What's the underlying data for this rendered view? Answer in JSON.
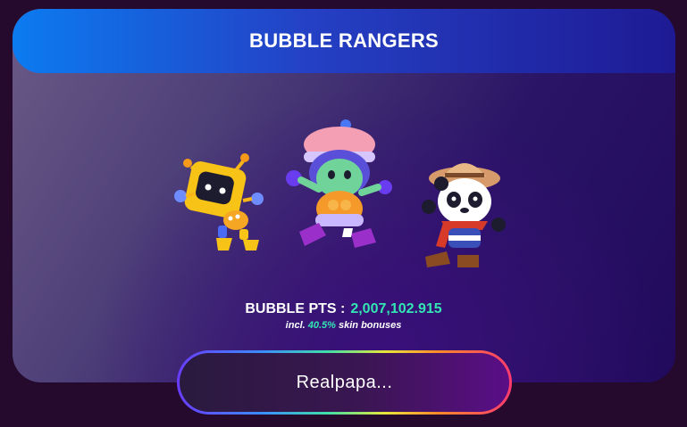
{
  "header": {
    "title": "BUBBLE RANGERS"
  },
  "characters": [
    {
      "icon": "robot-mascot-icon",
      "color": "#f7c316"
    },
    {
      "icon": "alien-girl-mascot-icon",
      "color": "#6fd39a"
    },
    {
      "icon": "panda-explorer-mascot-icon",
      "color": "#ffffff"
    }
  ],
  "stats": {
    "pts_label": "BUBBLE PTS :",
    "pts_value": "2,007,102.915",
    "bonus_prefix": "incl.",
    "bonus_value": "40.5%",
    "bonus_suffix": "skin bonuses"
  },
  "player": {
    "name_button_label": "Realpapa..."
  },
  "colors": {
    "accent": "#33e6b4",
    "header_start": "#0c7bf0",
    "header_end": "#1e1a94"
  }
}
